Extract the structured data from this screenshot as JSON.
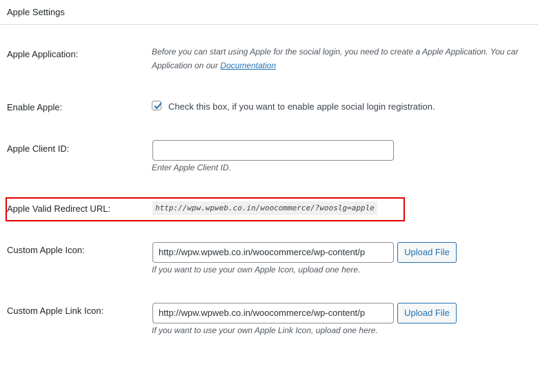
{
  "section": {
    "title": "Apple Settings"
  },
  "application": {
    "label": "Apple Application:",
    "desc_line1": "Before you can start using Apple for the social login, you need to create a Apple Application. You car",
    "desc_line2_prefix": "Application on our ",
    "doc_link": "Documentation"
  },
  "enable": {
    "label": "Enable Apple:",
    "checked": true,
    "checkbox_text": "Check this box, if you want to enable apple social login registration."
  },
  "client_id": {
    "label": "Apple Client ID:",
    "value": "",
    "hint": "Enter Apple Client ID."
  },
  "redirect": {
    "label": "Apple Valid Redirect URL:",
    "url": "http://wpw.wpweb.co.in/woocommerce/?wooslg=apple"
  },
  "icon": {
    "label": "Custom Apple Icon:",
    "value": "http://wpw.wpweb.co.in/woocommerce/wp-content/p",
    "button": "Upload File",
    "hint": "If you want to use your own Apple Icon, upload one here."
  },
  "link_icon": {
    "label": "Custom Apple Link Icon:",
    "value": "http://wpw.wpweb.co.in/woocommerce/wp-content/p",
    "button": "Upload File",
    "hint": "If you want to use your own Apple Link Icon, upload one here."
  },
  "colors": {
    "link": "#2271b1",
    "highlight": "#e00000",
    "check": "#2271b1"
  }
}
